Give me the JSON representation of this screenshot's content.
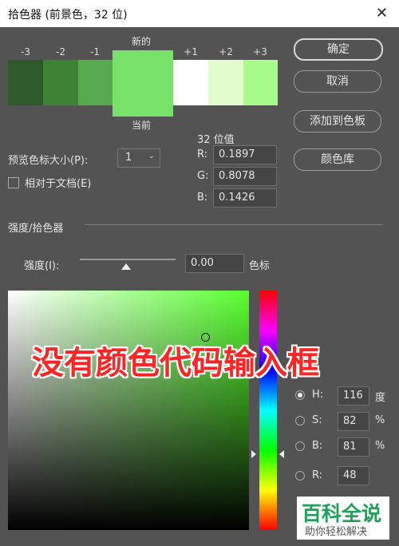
{
  "window": {
    "title": "拾色器 (前景色，32 位)",
    "close_glyph": "✕"
  },
  "swatches": {
    "new_label": "新的",
    "current_label": "当前",
    "items": [
      {
        "label": "-3",
        "color": "#2d5a28"
      },
      {
        "label": "-2",
        "color": "#3d8235"
      },
      {
        "label": "-1",
        "color": "#57aa4e"
      },
      {
        "label": "+1",
        "color": "#ffffff"
      },
      {
        "label": "+2",
        "color": "#e2fccc"
      },
      {
        "label": "+3",
        "color": "#a8fc8c"
      }
    ],
    "new_current_color": "#77e16a"
  },
  "buttons": {
    "ok": "确定",
    "cancel": "取消",
    "add_swatch": "添加到色板",
    "color_library": "颜色库"
  },
  "preview": {
    "size_label": "预览色标大小(P):",
    "size_value": "1",
    "relative_label": "相对于文档(E)"
  },
  "float32": {
    "title": "32 位值",
    "r_label": "R:",
    "r_value": "0.1897",
    "g_label": "G:",
    "g_value": "0.8078",
    "b_label": "B:",
    "b_value": "0.1426"
  },
  "intensity": {
    "section_label": "强度/拾色器",
    "label": "强度(I):",
    "value": "0.00",
    "unit": "色标",
    "slider_level": 0.5
  },
  "modes": {
    "h_label": "H:",
    "h_value": "116",
    "h_unit": "度",
    "s_label": "S:",
    "s_value": "82",
    "s_unit": "%",
    "b_label": "B:",
    "b_value": "81",
    "b_unit": "%",
    "r_label": "R:",
    "r_value": "48"
  },
  "overlay_text": "没有颜色代码输入框",
  "watermark": {
    "title": "百科全说",
    "subtitle": "助你轻松解决"
  }
}
